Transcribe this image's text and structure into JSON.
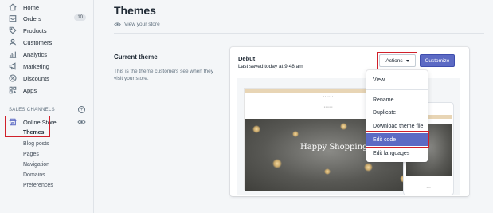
{
  "sidebar": {
    "items": [
      {
        "label": "Home",
        "icon": "home-icon"
      },
      {
        "label": "Orders",
        "icon": "orders-icon",
        "badge": "10"
      },
      {
        "label": "Products",
        "icon": "tag-icon"
      },
      {
        "label": "Customers",
        "icon": "person-icon"
      },
      {
        "label": "Analytics",
        "icon": "bar-chart-icon"
      },
      {
        "label": "Marketing",
        "icon": "megaphone-icon"
      },
      {
        "label": "Discounts",
        "icon": "discount-icon"
      },
      {
        "label": "Apps",
        "icon": "apps-icon"
      }
    ],
    "sales_channels_title": "SALES CHANNELS",
    "online_store": "Online Store",
    "subitems": [
      "Themes",
      "Blog posts",
      "Pages",
      "Navigation",
      "Domains",
      "Preferences"
    ]
  },
  "header": {
    "title": "Themes",
    "view_store": "View your store"
  },
  "current_theme": {
    "title": "Current theme",
    "description": "This is the theme customers see when they visit your store."
  },
  "card": {
    "theme_name": "Debut",
    "saved": "Last saved today at 9:48 am",
    "actions_label": "Actions",
    "customize_label": "Customize"
  },
  "preview": {
    "hero_text": "Happy Shopping"
  },
  "dropdown": {
    "view": "View",
    "rename": "Rename",
    "duplicate": "Duplicate",
    "download": "Download theme file",
    "edit_code": "Edit code",
    "edit_languages": "Edit languages"
  },
  "colors": {
    "accent": "#5c6ac4",
    "highlight_box": "#d0202a"
  }
}
